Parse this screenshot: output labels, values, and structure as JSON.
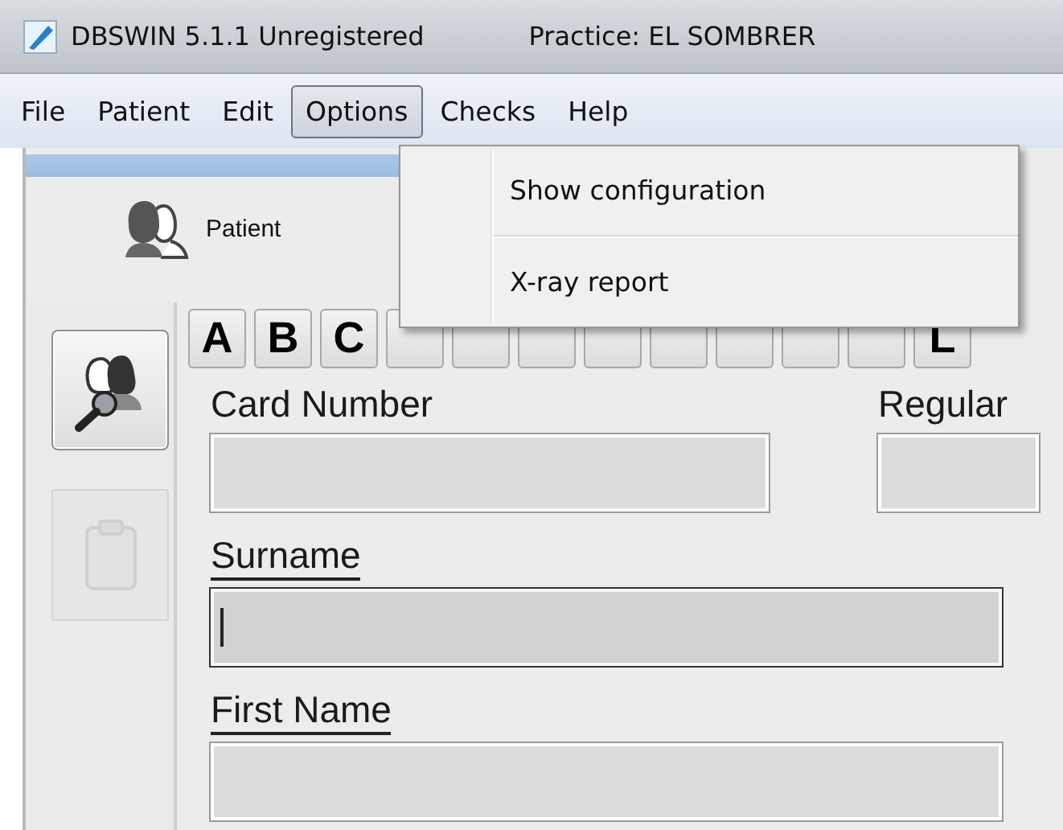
{
  "window": {
    "title": "DBSWIN 5.1.1 Unregistered",
    "practice": "Practice: EL SOMBRER"
  },
  "menu_bar": [
    {
      "label": "File",
      "selected": false
    },
    {
      "label": "Patient",
      "selected": false
    },
    {
      "label": "Edit",
      "selected": false
    },
    {
      "label": "Options",
      "selected": true
    },
    {
      "label": "Checks",
      "selected": false
    },
    {
      "label": "Help",
      "selected": false
    }
  ],
  "dropdown": {
    "items": [
      {
        "label": "Show configuration"
      },
      {
        "label": "X-ray report"
      }
    ]
  },
  "toolbar": {
    "tab": "Patient"
  },
  "side_buttons": [
    {
      "kind": "search",
      "disabled": false
    },
    {
      "kind": "clipboard",
      "disabled": true
    }
  ],
  "letters": [
    {
      "kind": "key",
      "label": "A"
    },
    {
      "kind": "key",
      "label": "B"
    },
    {
      "kind": "key",
      "label": "C"
    },
    {
      "kind": "covered"
    },
    {
      "kind": "covered"
    },
    {
      "kind": "covered"
    },
    {
      "kind": "covered"
    },
    {
      "kind": "covered"
    },
    {
      "kind": "covered"
    },
    {
      "kind": "covered"
    },
    {
      "kind": "covered"
    },
    {
      "kind": "key",
      "label": "L"
    }
  ],
  "fields": [
    {
      "label": "Card Number",
      "underlined": false,
      "focused": false
    },
    {
      "label": "Regular",
      "underlined": false,
      "focused": false
    },
    {
      "label": "Surname",
      "underlined": true,
      "focused": true
    },
    {
      "label": "First Name",
      "underlined": true,
      "focused": false
    }
  ]
}
